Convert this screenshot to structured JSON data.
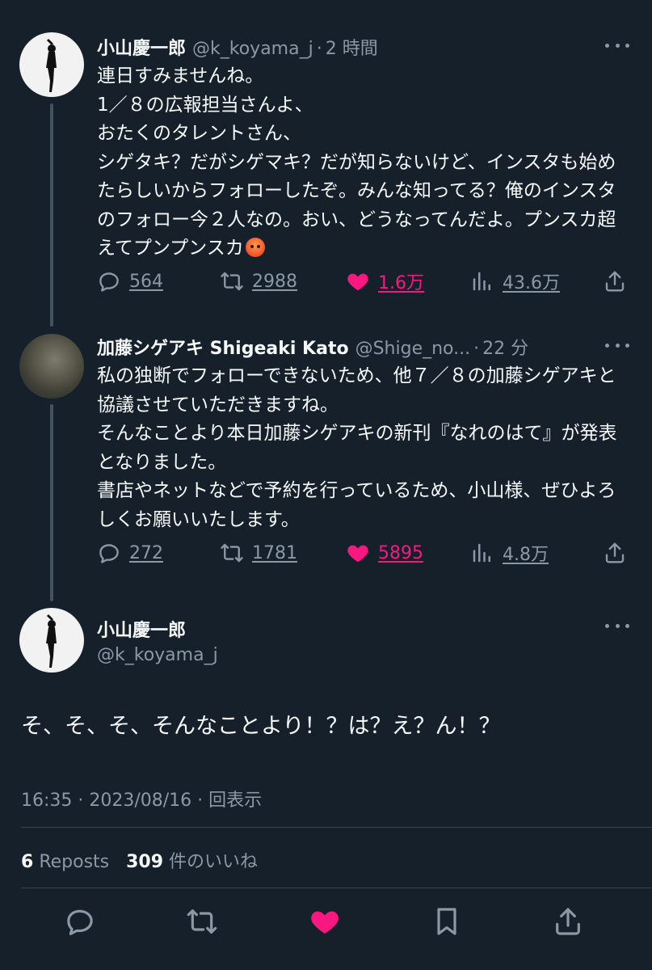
{
  "colors": {
    "background": "#15202b",
    "text": "#f7f9f9",
    "muted": "#8b98a5",
    "like": "#f91880",
    "thread_line": "#42535f"
  },
  "tweets": [
    {
      "name": "小山慶一郎",
      "handle": "@k_koyama_j",
      "separator": "·",
      "time": "2 時間",
      "text": "連日すみませんね。\n1／８の広報担当さんよ、\nおたくのタレントさん、\nシゲタキ？だがシゲマキ？だが知らないけど、インスタも始めたらしいからフォローしたぞ。みんな知ってる？俺のインスタのフォロー今２人なの。おい、どうなってんだよ。プンスカ超えてプンプンスカ",
      "emoji": "angry-face-emoji",
      "replies": "564",
      "reposts": "2988",
      "likes": "1.6万",
      "views": "43.6万"
    },
    {
      "name": "加藤シゲアキ Shigeaki Kato",
      "handle": "@Shige_no...",
      "separator": "·",
      "time": "22 分",
      "text": "私の独断でフォローできないため、他７／８の加藤シゲアキと協議させていただきますね。\nそんなことより本日加藤シゲアキの新刊『なれのはて』が発表となりました。\n書店やネットなどで予約を行っているため、小山様、ぜひよろしくお願いいたします。",
      "replies": "272",
      "reposts": "1781",
      "likes": "5895",
      "views": "4.8万"
    }
  ],
  "main_tweet": {
    "name": "小山慶一郎",
    "handle": "@k_koyama_j",
    "text": "そ、そ、そ、そんなことより！？は？え？ん！？",
    "meta": "16:35 · 2023/08/16 · 回表示",
    "reposts_count": "6",
    "reposts_label": "Reposts",
    "likes_count": "309",
    "likes_label": "件のいいね"
  },
  "icons": {
    "reply": "reply-icon",
    "repost": "repost-icon",
    "like": "heart-icon",
    "views": "views-icon",
    "share": "share-icon",
    "more": "more-icon",
    "bookmark": "bookmark-icon"
  }
}
